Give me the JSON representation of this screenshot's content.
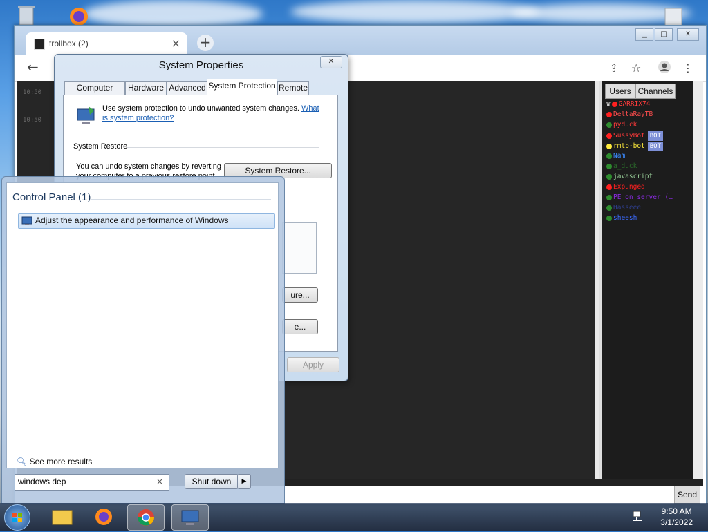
{
  "browser": {
    "tab_title": "trollbox (2)",
    "tab_close": "×",
    "new_tab": "+",
    "window_buttons": [
      "▭",
      "□",
      "✕"
    ]
  },
  "chat": {
    "timestamps": [
      "10:50",
      "10:50"
    ],
    "user_tabs": [
      "Users",
      "Channels"
    ],
    "users": [
      {
        "name": "GARRIX74",
        "color": "#ff3b3b",
        "dot": "#ff2020",
        "crown": true
      },
      {
        "name": "DeltaRayTB",
        "color": "#ff4d4d",
        "dot": "#ff2020"
      },
      {
        "name": "pyduck",
        "color": "#ff3a3a",
        "dot": "#2e8b2e"
      },
      {
        "name": "SussyBot",
        "color": "#ff3a3a",
        "dot": "#ff2020",
        "badge": "BOT"
      },
      {
        "name": "rmtb-bot",
        "color": "#ffeb3b",
        "dot": "#ffeb3b",
        "badge": "BOT"
      },
      {
        "name": "Nam",
        "color": "#3b8bff",
        "dot": "#2e8b2e"
      },
      {
        "name": "a_duck",
        "color": "#2a6b2a",
        "dot": "#2e8b2e"
      },
      {
        "name": "javascript",
        "color": "#9bd19b",
        "dot": "#2e8b2e"
      },
      {
        "name": "Expunged",
        "color": "#ff2020",
        "dot": "#ff2020"
      },
      {
        "name": "PE on server (…",
        "color": "#8a2be2",
        "dot": "#2e8b2e"
      },
      {
        "name": "Hasseee",
        "color": "#2f3f8f",
        "dot": "#2e8b2e"
      },
      {
        "name": "sheesh",
        "color": "#3b6bff",
        "dot": "#2e8b2e"
      }
    ],
    "send_label": "Send"
  },
  "system_properties": {
    "title": "System Properties",
    "close": "✕",
    "tabs": [
      "Computer Name",
      "Hardware",
      "Advanced",
      "System Protection",
      "Remote"
    ],
    "active_tab": "System Protection",
    "intro_text": "Use system protection to undo unwanted system changes.",
    "intro_link_1": "What",
    "intro_link_2": "is system protection?",
    "section_system_restore": "System Restore",
    "restore_text": "You can undo system changes by reverting",
    "restore_text_2": "your computer to a previous restore point.",
    "system_restore_button": "System Restore...",
    "configure_button_partial": "ure...",
    "create_button_partial": "e...",
    "apply_button": "Apply"
  },
  "start_menu": {
    "group_heading": "Control Panel (1)",
    "result_item": "Adjust the appearance and performance of Windows",
    "see_more": "See more results",
    "search_value": "windows dep",
    "search_clear": "×",
    "shutdown_label": "Shut down",
    "shutdown_arrow": "▶"
  },
  "taskbar": {
    "time": "9:50 AM",
    "date": "3/1/2022"
  }
}
